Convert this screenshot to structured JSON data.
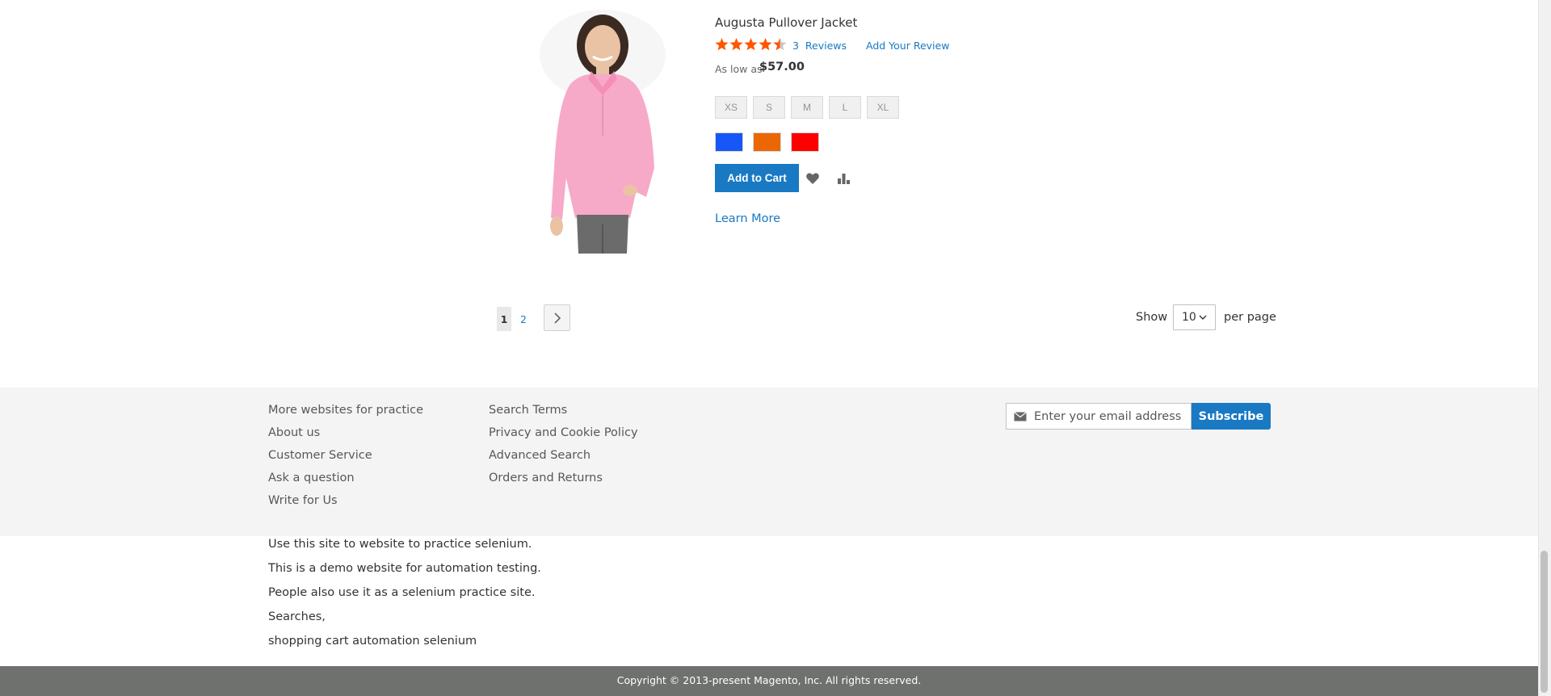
{
  "product": {
    "name": "Augusta Pullover Jacket",
    "rating": {
      "stars": 4.5,
      "max": 5
    },
    "reviews_count": "3",
    "reviews_label": "Reviews",
    "add_review_label": "Add Your Review",
    "price_prefix": "As low as",
    "price": "$57.00",
    "sizes": [
      "XS",
      "S",
      "M",
      "L",
      "XL"
    ],
    "colors": [
      "#1857f7",
      "#eb6703",
      "#ff0000"
    ],
    "add_to_cart_label": "Add to Cart",
    "wishlist_icon": "heart-icon",
    "compare_icon": "bar-chart-icon",
    "learn_more_label": "Learn More",
    "image_colors": {
      "jacket": "#f7a9c8",
      "pants": "#6b6b6b",
      "skin": "#e9c3a4",
      "hair": "#3a2a22"
    }
  },
  "pager": {
    "current_page": "1",
    "next_page": "2",
    "next_icon": "chevron-right-icon",
    "show_label": "Show",
    "limit_value": "10",
    "per_page_label": "per page"
  },
  "footer": {
    "links_col1": [
      "More websites for practice",
      "About us",
      "Customer Service",
      "Ask a question",
      "Write for Us"
    ],
    "links_col2": [
      "Search Terms",
      "Privacy and Cookie Policy",
      "Advanced Search",
      "Orders and Returns"
    ],
    "newsletter_placeholder": "Enter your email address",
    "newsletter_icon": "envelope-icon",
    "subscribe_label": "Subscribe",
    "about_lines": [
      "Use this site to website to practice selenium.",
      "This is a demo website for automation testing.",
      "People also use it as a selenium practice site.",
      "Searches,",
      "shopping cart automation selenium"
    ],
    "copyright": "Copyright © 2013-present Magento, Inc. All rights reserved."
  },
  "colors": {
    "accent": "#1979c3",
    "star": "#ff5501",
    "footer_bg": "#f4f4f4",
    "copyright_bg": "#6e716e"
  }
}
